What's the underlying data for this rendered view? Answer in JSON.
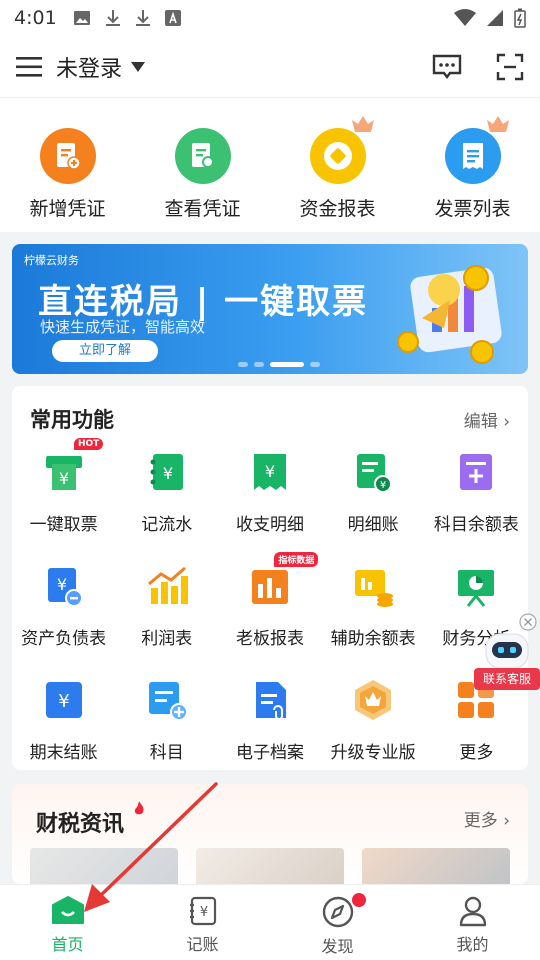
{
  "status": {
    "time": "4:01"
  },
  "header": {
    "login": "未登录"
  },
  "quick": [
    {
      "label": "新增凭证",
      "icon": "add-voucher-icon",
      "color": "#f5801e"
    },
    {
      "label": "查看凭证",
      "icon": "view-voucher-icon",
      "color": "#3cc173"
    },
    {
      "label": "资金报表",
      "icon": "fund-report-icon",
      "color": "#f8c400"
    },
    {
      "label": "发票列表",
      "icon": "invoice-list-icon",
      "color": "#2c9cf0"
    }
  ],
  "banner": {
    "brand": "柠檬云财务",
    "title": "直连税局 | 一键取票",
    "subtitle": "快速生成凭证，智能高效",
    "button": "立即了解"
  },
  "common": {
    "title": "常用功能",
    "edit": "编辑",
    "items": [
      {
        "label": "一键取票",
        "icon": "ticket-icon",
        "tag": "HOT"
      },
      {
        "label": "记流水",
        "icon": "cash-flow-icon"
      },
      {
        "label": "收支明细",
        "icon": "income-expense-icon"
      },
      {
        "label": "明细账",
        "icon": "detail-ledger-icon"
      },
      {
        "label": "科目余额表",
        "icon": "account-balance-icon"
      },
      {
        "label": "资产负债表",
        "icon": "balance-sheet-icon"
      },
      {
        "label": "利润表",
        "icon": "profit-chart-icon"
      },
      {
        "label": "老板报表",
        "icon": "boss-report-icon",
        "tag": "指标数据"
      },
      {
        "label": "辅助余额表",
        "icon": "aux-balance-icon"
      },
      {
        "label": "财务分析",
        "icon": "finance-analysis-icon"
      },
      {
        "label": "期末结账",
        "icon": "period-close-icon"
      },
      {
        "label": "科目",
        "icon": "subject-icon"
      },
      {
        "label": "电子档案",
        "icon": "e-archive-icon"
      },
      {
        "label": "升级专业版",
        "icon": "upgrade-icon"
      },
      {
        "label": "更多",
        "icon": "more-grid-icon"
      }
    ]
  },
  "news": {
    "title": "财税资讯",
    "more": "更多"
  },
  "fab": {
    "label": "联系客服"
  },
  "tabs": [
    {
      "label": "首页",
      "icon": "home-icon",
      "active": true
    },
    {
      "label": "记账",
      "icon": "bookkeeping-icon"
    },
    {
      "label": "发现",
      "icon": "discover-icon"
    },
    {
      "label": "我的",
      "icon": "profile-icon"
    }
  ]
}
